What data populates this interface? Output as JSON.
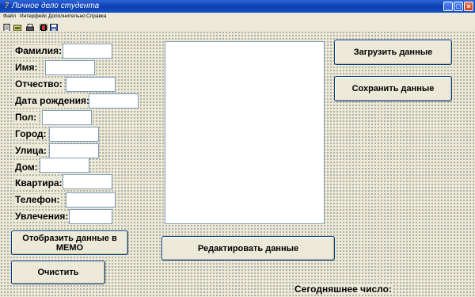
{
  "window": {
    "title": "Личное дело студента"
  },
  "menu": [
    "Файл",
    "Интерфейс",
    "Дополнительно",
    "Справка"
  ],
  "toolbar_icons": [
    "document-icon",
    "open-folder-icon",
    "printer-icon",
    "film-icon",
    "save-icon"
  ],
  "fields": [
    {
      "label": "Фамилия:",
      "value": ""
    },
    {
      "label": "Имя:",
      "value": ""
    },
    {
      "label": "Отчество:",
      "value": ""
    },
    {
      "label": "Дата рождения:",
      "value": ""
    },
    {
      "label": "Пол:",
      "value": ""
    },
    {
      "label": "Город:",
      "value": ""
    },
    {
      "label": "Улица:",
      "value": ""
    },
    {
      "label": "Дом:",
      "value": ""
    },
    {
      "label": "Квартира:",
      "value": ""
    },
    {
      "label": "Телефон:",
      "value": ""
    },
    {
      "label": "Увлечения:",
      "value": ""
    }
  ],
  "buttons": {
    "load": "Загрузить данные",
    "save": "Сохранить данные",
    "show_memo": "Отобразить данные в MEMO",
    "edit": "Редактировать данные",
    "clear": "Очистить"
  },
  "footer": {
    "today_label": "Сегодняшнее число:"
  }
}
